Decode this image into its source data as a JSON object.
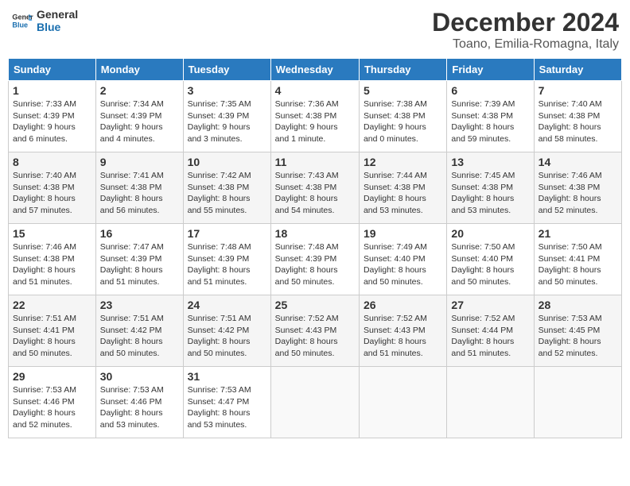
{
  "header": {
    "logo_line1": "General",
    "logo_line2": "Blue",
    "month": "December 2024",
    "location": "Toano, Emilia-Romagna, Italy"
  },
  "days_of_week": [
    "Sunday",
    "Monday",
    "Tuesday",
    "Wednesday",
    "Thursday",
    "Friday",
    "Saturday"
  ],
  "weeks": [
    [
      {
        "day": "1",
        "info": "Sunrise: 7:33 AM\nSunset: 4:39 PM\nDaylight: 9 hours\nand 6 minutes."
      },
      {
        "day": "2",
        "info": "Sunrise: 7:34 AM\nSunset: 4:39 PM\nDaylight: 9 hours\nand 4 minutes."
      },
      {
        "day": "3",
        "info": "Sunrise: 7:35 AM\nSunset: 4:39 PM\nDaylight: 9 hours\nand 3 minutes."
      },
      {
        "day": "4",
        "info": "Sunrise: 7:36 AM\nSunset: 4:38 PM\nDaylight: 9 hours\nand 1 minute."
      },
      {
        "day": "5",
        "info": "Sunrise: 7:38 AM\nSunset: 4:38 PM\nDaylight: 9 hours\nand 0 minutes."
      },
      {
        "day": "6",
        "info": "Sunrise: 7:39 AM\nSunset: 4:38 PM\nDaylight: 8 hours\nand 59 minutes."
      },
      {
        "day": "7",
        "info": "Sunrise: 7:40 AM\nSunset: 4:38 PM\nDaylight: 8 hours\nand 58 minutes."
      }
    ],
    [
      {
        "day": "8",
        "info": "Sunrise: 7:40 AM\nSunset: 4:38 PM\nDaylight: 8 hours\nand 57 minutes."
      },
      {
        "day": "9",
        "info": "Sunrise: 7:41 AM\nSunset: 4:38 PM\nDaylight: 8 hours\nand 56 minutes."
      },
      {
        "day": "10",
        "info": "Sunrise: 7:42 AM\nSunset: 4:38 PM\nDaylight: 8 hours\nand 55 minutes."
      },
      {
        "day": "11",
        "info": "Sunrise: 7:43 AM\nSunset: 4:38 PM\nDaylight: 8 hours\nand 54 minutes."
      },
      {
        "day": "12",
        "info": "Sunrise: 7:44 AM\nSunset: 4:38 PM\nDaylight: 8 hours\nand 53 minutes."
      },
      {
        "day": "13",
        "info": "Sunrise: 7:45 AM\nSunset: 4:38 PM\nDaylight: 8 hours\nand 53 minutes."
      },
      {
        "day": "14",
        "info": "Sunrise: 7:46 AM\nSunset: 4:38 PM\nDaylight: 8 hours\nand 52 minutes."
      }
    ],
    [
      {
        "day": "15",
        "info": "Sunrise: 7:46 AM\nSunset: 4:38 PM\nDaylight: 8 hours\nand 51 minutes."
      },
      {
        "day": "16",
        "info": "Sunrise: 7:47 AM\nSunset: 4:39 PM\nDaylight: 8 hours\nand 51 minutes."
      },
      {
        "day": "17",
        "info": "Sunrise: 7:48 AM\nSunset: 4:39 PM\nDaylight: 8 hours\nand 51 minutes."
      },
      {
        "day": "18",
        "info": "Sunrise: 7:48 AM\nSunset: 4:39 PM\nDaylight: 8 hours\nand 50 minutes."
      },
      {
        "day": "19",
        "info": "Sunrise: 7:49 AM\nSunset: 4:40 PM\nDaylight: 8 hours\nand 50 minutes."
      },
      {
        "day": "20",
        "info": "Sunrise: 7:50 AM\nSunset: 4:40 PM\nDaylight: 8 hours\nand 50 minutes."
      },
      {
        "day": "21",
        "info": "Sunrise: 7:50 AM\nSunset: 4:41 PM\nDaylight: 8 hours\nand 50 minutes."
      }
    ],
    [
      {
        "day": "22",
        "info": "Sunrise: 7:51 AM\nSunset: 4:41 PM\nDaylight: 8 hours\nand 50 minutes."
      },
      {
        "day": "23",
        "info": "Sunrise: 7:51 AM\nSunset: 4:42 PM\nDaylight: 8 hours\nand 50 minutes."
      },
      {
        "day": "24",
        "info": "Sunrise: 7:51 AM\nSunset: 4:42 PM\nDaylight: 8 hours\nand 50 minutes."
      },
      {
        "day": "25",
        "info": "Sunrise: 7:52 AM\nSunset: 4:43 PM\nDaylight: 8 hours\nand 50 minutes."
      },
      {
        "day": "26",
        "info": "Sunrise: 7:52 AM\nSunset: 4:43 PM\nDaylight: 8 hours\nand 51 minutes."
      },
      {
        "day": "27",
        "info": "Sunrise: 7:52 AM\nSunset: 4:44 PM\nDaylight: 8 hours\nand 51 minutes."
      },
      {
        "day": "28",
        "info": "Sunrise: 7:53 AM\nSunset: 4:45 PM\nDaylight: 8 hours\nand 52 minutes."
      }
    ],
    [
      {
        "day": "29",
        "info": "Sunrise: 7:53 AM\nSunset: 4:46 PM\nDaylight: 8 hours\nand 52 minutes."
      },
      {
        "day": "30",
        "info": "Sunrise: 7:53 AM\nSunset: 4:46 PM\nDaylight: 8 hours\nand 53 minutes."
      },
      {
        "day": "31",
        "info": "Sunrise: 7:53 AM\nSunset: 4:47 PM\nDaylight: 8 hours\nand 53 minutes."
      },
      null,
      null,
      null,
      null
    ]
  ]
}
